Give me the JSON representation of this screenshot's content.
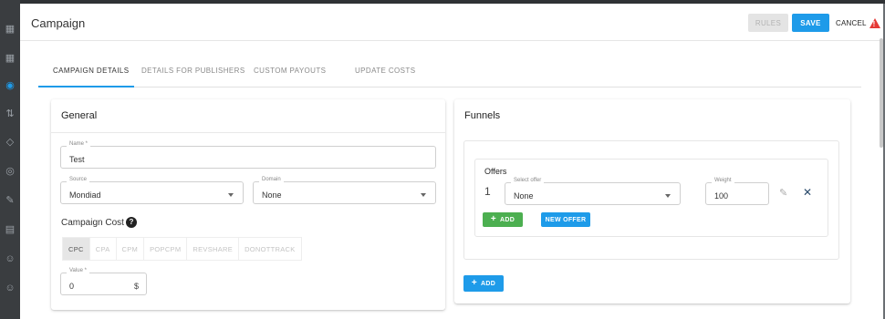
{
  "colors": {
    "primary": "#1e9be9",
    "success": "#4caf50",
    "danger": "#e53935"
  },
  "header": {
    "title": "Campaign",
    "rules_label": "RULES",
    "save_label": "SAVE",
    "cancel_label": "CANCEL"
  },
  "tabs": [
    {
      "label": "CAMPAIGN DETAILS",
      "active": true
    },
    {
      "label": "DETAILS FOR PUBLISHERS",
      "active": false
    },
    {
      "label": "CUSTOM PAYOUTS",
      "active": false
    },
    {
      "label": "UPDATE COSTS",
      "active": false
    }
  ],
  "general": {
    "title": "General",
    "name": {
      "label": "Name *",
      "value": "Test"
    },
    "source": {
      "label": "Source",
      "value": "Mondiad"
    },
    "domain": {
      "label": "Domain",
      "value": "None"
    },
    "campaign_cost_label": "Campaign Cost",
    "cost_types": [
      "CPC",
      "CPA",
      "CPM",
      "POPCPM",
      "REVSHARE",
      "DONOTTRACK"
    ],
    "cost_selected": "CPC",
    "value": {
      "label": "Value *",
      "value": "0",
      "suffix": "$"
    }
  },
  "funnels": {
    "title": "Funnels",
    "offers_title": "Offers",
    "offer_index": "1",
    "select_offer": {
      "label": "Select offer",
      "value": "None"
    },
    "weight": {
      "label": "Weight",
      "value": "100"
    },
    "add_label": "ADD",
    "new_offer_label": "NEW OFFER",
    "add_funnel_label": "ADD"
  }
}
